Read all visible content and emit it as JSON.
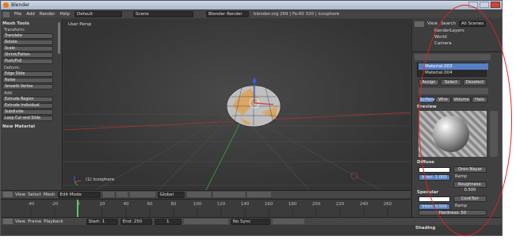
{
  "window": {
    "title": "Blender"
  },
  "menu": {
    "items": [
      "File",
      "Add",
      "Render",
      "Help"
    ],
    "layout": "Default",
    "scene": "Scene",
    "engine": "Blender Render",
    "info": "blender.org 269 | Fa:60 320 | Icosphere"
  },
  "tools": {
    "header": "Mesh Tools",
    "transform": {
      "label": "Transform:",
      "items": [
        "Translate",
        "Rotate",
        "Scale",
        "Shrink/Fatten",
        "Push/Pull"
      ]
    },
    "deform": {
      "label": "Deform:",
      "items": [
        "Edge Slide",
        "Noise",
        "Smooth Vertex"
      ]
    },
    "add": {
      "label": "Add:",
      "items": [
        "Extrude Region",
        "Extrude Individual",
        "Subdivide",
        "Loop Cut and Slide"
      ]
    },
    "new_material": "New Material"
  },
  "viewport": {
    "label": "User Persp",
    "object": "(1) Icosphere"
  },
  "viewport_header": {
    "view": "View",
    "select": "Select",
    "mesh": "Mesh",
    "mode": "Edit Mode",
    "orientation": "Global"
  },
  "timeline": {
    "ticks": [
      "-40",
      "-20",
      "0",
      "20",
      "40",
      "60",
      "80",
      "100",
      "120",
      "140",
      "160",
      "180",
      "200",
      "220",
      "240",
      "260"
    ],
    "current_frame": 1
  },
  "timeline_header": {
    "view": "View",
    "frame": "Frame",
    "playback": "Playback",
    "start": "Start: 1",
    "end": "End: 250",
    "current": "1",
    "sync": "No Sync"
  },
  "outliner": {
    "view": "View",
    "search": "Search",
    "scope": "All Scenes",
    "items": [
      "RenderLayers",
      "World",
      "Camera"
    ]
  },
  "properties": {
    "materials": [
      "Material.003",
      "Material.004"
    ],
    "assign": "Assign",
    "select": "Select",
    "deselect": "Deselect",
    "tabs": [
      "Surface",
      "Wire",
      "Volume",
      "Halo"
    ],
    "preview": "Preview",
    "diffuse": {
      "header": "Diffuse",
      "shader": "Oren-Nayar",
      "intensity": "Inten: 1.000",
      "ramp": "Ramp",
      "roughness": "Roughness: 0.500"
    },
    "specular": {
      "header": "Specular",
      "shader": "CookTorr",
      "intensity": "Inten: 0.500",
      "ramp": "Ramp",
      "hardness": "Hardness: 50"
    },
    "shading": "Shading"
  },
  "colors": {
    "accent": "#5680c2",
    "annotation": "#e32222"
  }
}
